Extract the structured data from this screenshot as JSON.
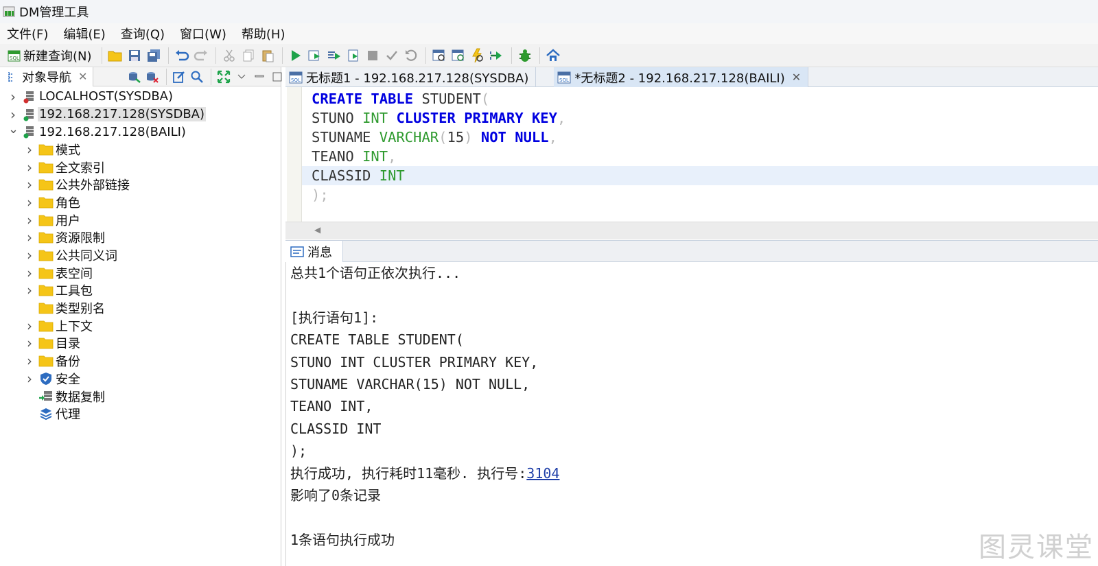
{
  "window": {
    "title": "DM管理工具"
  },
  "menu": [
    "文件(F)",
    "编辑(E)",
    "查询(Q)",
    "窗口(W)",
    "帮助(H)"
  ],
  "toolbar": {
    "new_query_label": "新建查询(N)"
  },
  "left_panel": {
    "tab_label": "对象导航",
    "tree": [
      {
        "label": "LOCALHOST(SYSDBA)",
        "level": 0,
        "expander": "collapsed",
        "icon": "server-red-icon"
      },
      {
        "label": "192.168.217.128(SYSDBA)",
        "level": 0,
        "expander": "collapsed",
        "icon": "server-green-icon",
        "selected": true
      },
      {
        "label": "192.168.217.128(BAILI)",
        "level": 0,
        "expander": "expanded",
        "icon": "server-green-icon"
      },
      {
        "label": "模式",
        "level": 1,
        "expander": "collapsed",
        "icon": "folder-icon"
      },
      {
        "label": "全文索引",
        "level": 1,
        "expander": "collapsed",
        "icon": "folder-icon"
      },
      {
        "label": "公共外部链接",
        "level": 1,
        "expander": "collapsed",
        "icon": "folder-icon"
      },
      {
        "label": "角色",
        "level": 1,
        "expander": "collapsed",
        "icon": "folder-icon"
      },
      {
        "label": "用户",
        "level": 1,
        "expander": "collapsed",
        "icon": "folder-icon"
      },
      {
        "label": "资源限制",
        "level": 1,
        "expander": "collapsed",
        "icon": "folder-icon"
      },
      {
        "label": "公共同义词",
        "level": 1,
        "expander": "collapsed",
        "icon": "folder-icon"
      },
      {
        "label": "表空间",
        "level": 1,
        "expander": "collapsed",
        "icon": "folder-icon"
      },
      {
        "label": "工具包",
        "level": 1,
        "expander": "collapsed",
        "icon": "folder-icon"
      },
      {
        "label": "类型别名",
        "level": 1,
        "expander": "none",
        "icon": "folder-icon"
      },
      {
        "label": "上下文",
        "level": 1,
        "expander": "collapsed",
        "icon": "folder-icon"
      },
      {
        "label": "目录",
        "level": 1,
        "expander": "collapsed",
        "icon": "folder-icon"
      },
      {
        "label": "备份",
        "level": 1,
        "expander": "collapsed",
        "icon": "folder-icon"
      },
      {
        "label": "安全",
        "level": 1,
        "expander": "collapsed",
        "icon": "shield-icon"
      },
      {
        "label": "数据复制",
        "level": 1,
        "expander": "none",
        "icon": "replication-icon"
      },
      {
        "label": "代理",
        "level": 1,
        "expander": "none",
        "icon": "layers-icon"
      }
    ]
  },
  "editor": {
    "tabs": [
      {
        "label": "无标题1 - 192.168.217.128(SYSDBA)",
        "active": false,
        "closable": false
      },
      {
        "label": "*无标题2 - 192.168.217.128(BAILI)",
        "active": true,
        "closable": true
      }
    ],
    "code_lines": [
      [
        {
          "t": "CREATE",
          "c": "kw"
        },
        {
          "t": " ",
          "c": "pl"
        },
        {
          "t": "TABLE",
          "c": "kw"
        },
        {
          "t": " STUDENT",
          "c": "pl"
        },
        {
          "t": "(",
          "c": "pu"
        }
      ],
      [
        {
          "t": "STUNO ",
          "c": "pl"
        },
        {
          "t": "INT",
          "c": "ty"
        },
        {
          "t": " ",
          "c": "pl"
        },
        {
          "t": "CLUSTER",
          "c": "kw"
        },
        {
          "t": " ",
          "c": "pl"
        },
        {
          "t": "PRIMARY",
          "c": "kw"
        },
        {
          "t": " ",
          "c": "pl"
        },
        {
          "t": "KEY",
          "c": "kw"
        },
        {
          "t": ",",
          "c": "pu"
        }
      ],
      [
        {
          "t": "STUNAME ",
          "c": "pl"
        },
        {
          "t": "VARCHAR",
          "c": "ty"
        },
        {
          "t": "(",
          "c": "pu"
        },
        {
          "t": "15",
          "c": "nm"
        },
        {
          "t": ")",
          "c": "pu"
        },
        {
          "t": " ",
          "c": "pl"
        },
        {
          "t": "NOT",
          "c": "kw"
        },
        {
          "t": " ",
          "c": "pl"
        },
        {
          "t": "NULL",
          "c": "kw"
        },
        {
          "t": ",",
          "c": "pu"
        }
      ],
      [
        {
          "t": "TEANO ",
          "c": "pl"
        },
        {
          "t": "INT",
          "c": "ty"
        },
        {
          "t": ",",
          "c": "pu"
        }
      ],
      [
        {
          "t": "CLASSID ",
          "c": "pl"
        },
        {
          "t": "INT",
          "c": "ty"
        }
      ],
      [
        {
          "t": ");",
          "c": "pu"
        }
      ]
    ]
  },
  "messages": {
    "tab_label": "消息",
    "lines": [
      "总共1个语句正依次执行...",
      "",
      "[执行语句1]:",
      "CREATE TABLE STUDENT(",
      "STUNO INT CLUSTER PRIMARY KEY,",
      "STUNAME VARCHAR(15) NOT NULL,",
      "TEANO INT,",
      "CLASSID INT",
      ");"
    ],
    "result_prefix": "执行成功, 执行耗时11毫秒. 执行号:",
    "exec_number": "3104",
    "affected": "影响了0条记录",
    "summary": "1条语句执行成功"
  },
  "watermark": "图灵课堂",
  "colors": {
    "keyword": "#0000e0",
    "type": "#2e9a2e",
    "link": "#1f3fa8",
    "folder": "#f5c518",
    "active_tab": "#d9e6f5"
  }
}
